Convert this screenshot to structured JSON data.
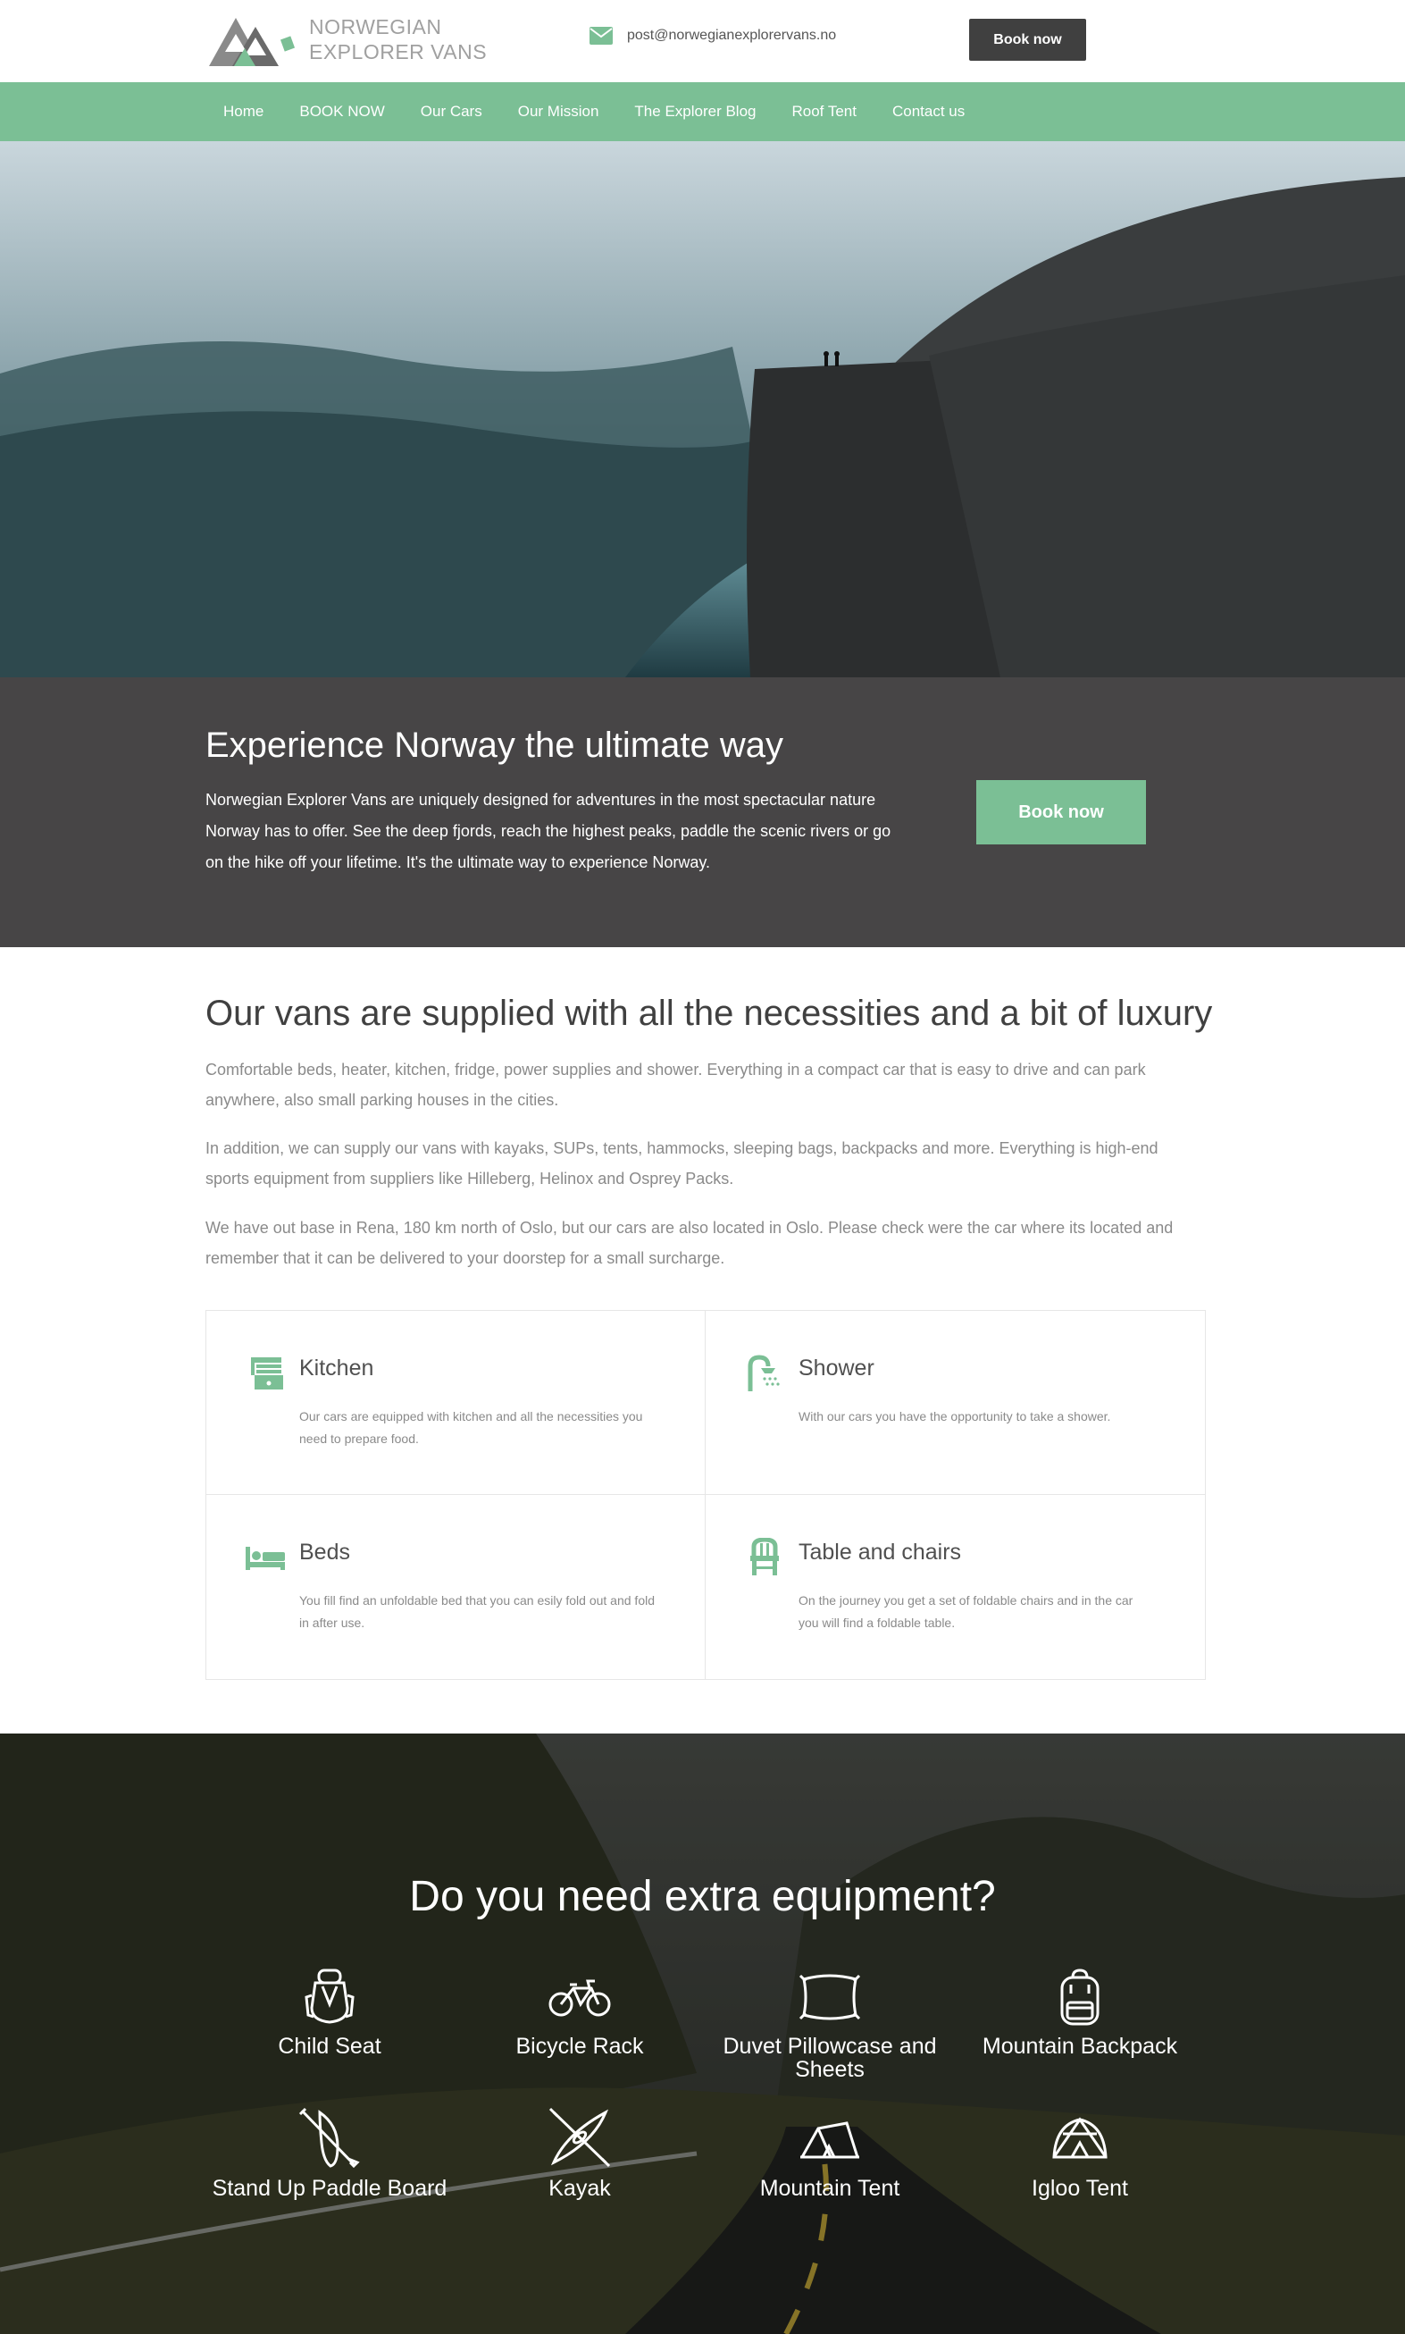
{
  "header": {
    "logo_line1": "NORWEGIAN",
    "logo_line2": "EXPLORER VANS",
    "email": "post@norwegianexplorervans.no",
    "book_label": "Book now"
  },
  "nav": {
    "items": [
      "Home",
      "BOOK NOW",
      "Our Cars",
      "Our Mission",
      "The Explorer Blog",
      "Roof Tent",
      "Contact us"
    ]
  },
  "cta": {
    "title": "Experience Norway the ultimate way",
    "text": "Norwegian Explorer Vans are uniquely designed for adventures in the most spectacular nature Norway has to offer. See the deep fjords, reach the highest peaks, paddle the scenic rivers or go on the hike off your lifetime. It's the ultimate way to experience Norway.",
    "book_label": "Book now"
  },
  "supplies": {
    "title": "Our vans are supplied with all the necessities and a bit of luxury",
    "paragraphs": [
      "Comfortable beds, heater, kitchen, fridge, power supplies and shower. Everything in a compact car that is easy to drive and can park anywhere, also small parking houses in the cities.",
      "In addition, we can supply our vans with kayaks, SUPs, tents, hammocks, sleeping bags, backpacks and more. Everything is high-end sports equipment from suppliers like Hilleberg, Helinox and Osprey Packs.",
      "We have out base in Rena, 180 km north of Oslo, but our cars are also located in Oslo. Please check were the car where its located and remember that it can be delivered to your doorstep for a small surcharge."
    ]
  },
  "features": [
    {
      "title": "Kitchen",
      "desc": "Our cars are equipped with kitchen and all the necessities you need to prepare food.",
      "icon": "kitchen-icon"
    },
    {
      "title": "Shower",
      "desc": "With our cars you have the opportunity to take a shower.",
      "icon": "shower-icon"
    },
    {
      "title": "Beds",
      "desc": "You fill find an unfoldable bed that you can esily fold out and fold in after use.",
      "icon": "bed-icon"
    },
    {
      "title": "Table and chairs",
      "desc": "On the journey you get a set of foldable chairs and in the car you will find a foldable table.",
      "icon": "chair-icon"
    }
  ],
  "equipment": {
    "title": "Do you need extra equipment?",
    "items": [
      {
        "label": "Child Seat",
        "icon": "child-seat-icon"
      },
      {
        "label": "Bicycle Rack",
        "icon": "bicycle-icon"
      },
      {
        "label": "Duvet Pillowcase and Sheets",
        "icon": "pillow-icon"
      },
      {
        "label": "Mountain Backpack",
        "icon": "backpack-icon"
      },
      {
        "label": "Stand Up Paddle Board",
        "icon": "paddle-board-icon"
      },
      {
        "label": "Kayak",
        "icon": "kayak-icon"
      },
      {
        "label": "Mountain Tent",
        "icon": "tent-icon"
      },
      {
        "label": "Igloo Tent",
        "icon": "igloo-tent-icon"
      }
    ]
  },
  "colors": {
    "accent": "#7bbf95",
    "dark": "#404040",
    "cta_bg": "#474546"
  }
}
